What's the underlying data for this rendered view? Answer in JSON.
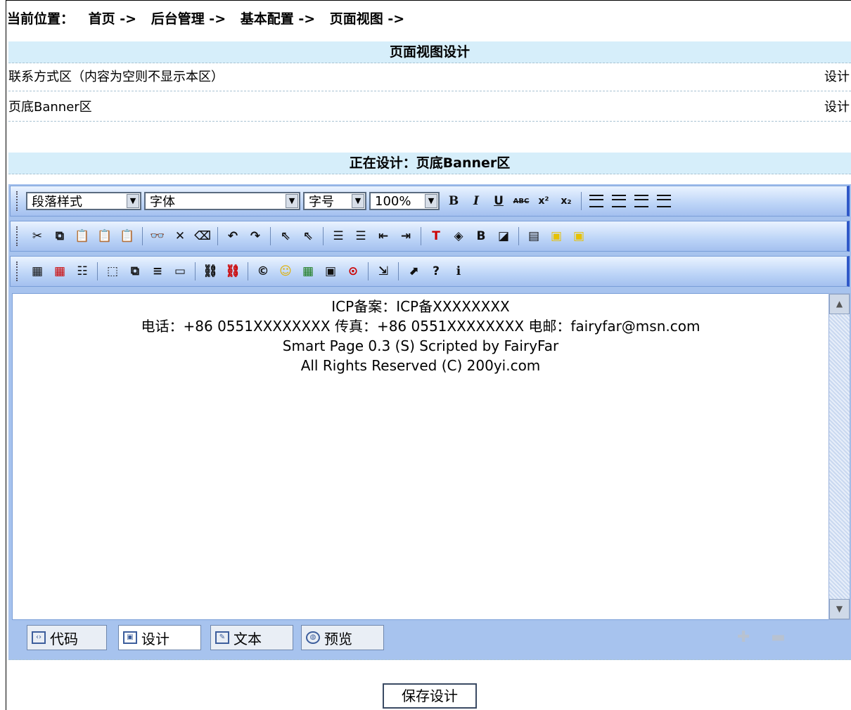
{
  "breadcrumb": {
    "label": "当前位置：",
    "items": [
      "首页 ->",
      "后台管理 ->",
      "基本配置 ->",
      "页面视图 ->"
    ]
  },
  "page_title": "页面视图设计",
  "rows": [
    {
      "label": "联系方式区（内容为空则不显示本区）",
      "action": "设计"
    },
    {
      "label": "页底Banner区",
      "action": "设计"
    }
  ],
  "editing_title": "正在设计：页底Banner区",
  "toolbar": {
    "paragraph_style": "段落样式",
    "font": "字体",
    "font_size": "字号",
    "zoom": "100%",
    "bold": "B",
    "italic": "I",
    "underline": "U",
    "strike": "ABC",
    "superscript": "x²",
    "subscript": "x₂"
  },
  "content_lines": [
    "ICP备案：ICP备XXXXXXXX",
    "电话：+86 0551XXXXXXXX 传真：+86 0551XXXXXXXX 电邮：fairyfar@msn.com",
    "Smart Page 0.3 (S) Scripted by FairyFar",
    "All Rights Reserved (C) 200yi.com"
  ],
  "modes": [
    {
      "label": "代码",
      "icon": "code-icon"
    },
    {
      "label": "设计",
      "icon": "design-icon",
      "active": true
    },
    {
      "label": "文本",
      "icon": "text-icon"
    },
    {
      "label": "预览",
      "icon": "globe-icon"
    }
  ],
  "save_label": "保存设计"
}
